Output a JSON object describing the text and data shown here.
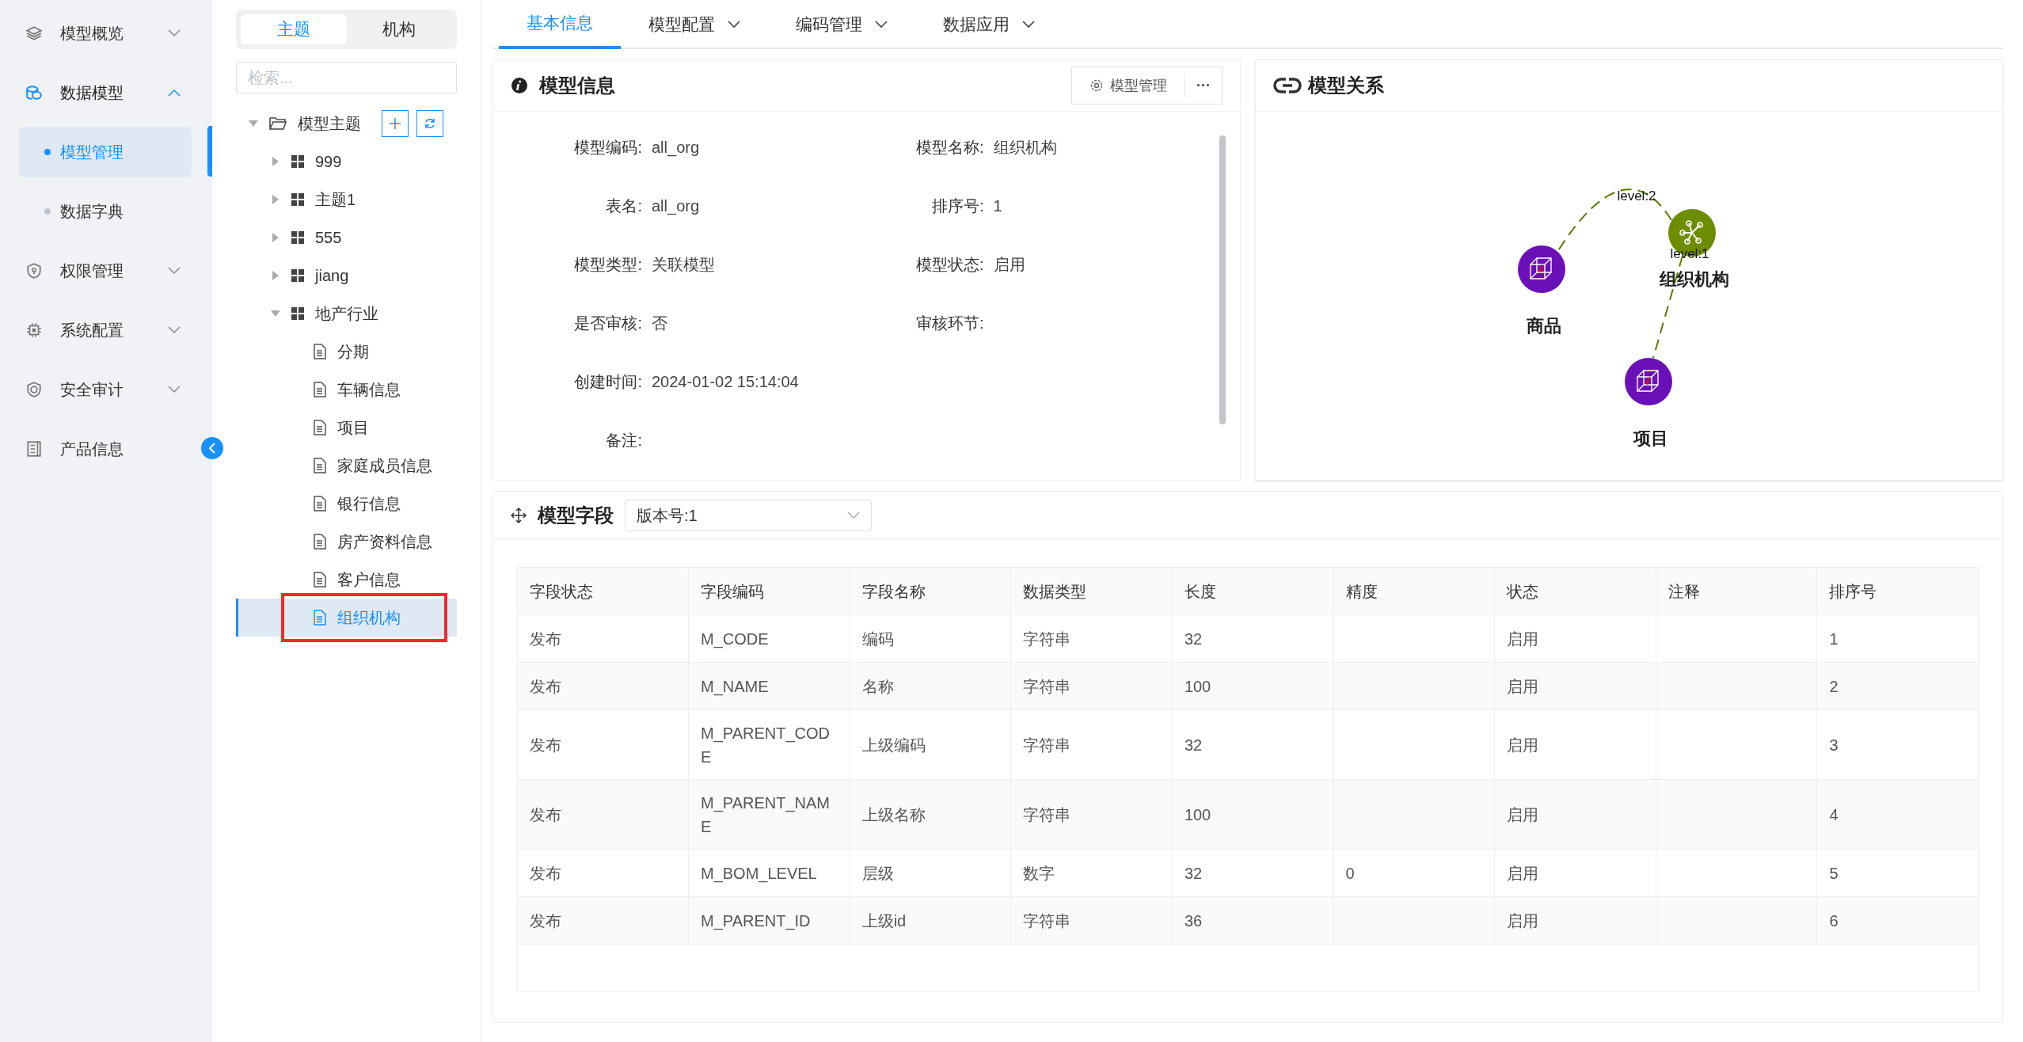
{
  "sidebar": {
    "items": [
      {
        "label": "模型概览",
        "expanded": false
      },
      {
        "label": "数据模型",
        "expanded": true,
        "children": [
          {
            "label": "模型管理",
            "selected": true
          },
          {
            "label": "数据字典",
            "selected": false
          }
        ]
      },
      {
        "label": "权限管理",
        "expanded": false
      },
      {
        "label": "系统配置",
        "expanded": false
      },
      {
        "label": "安全审计",
        "expanded": false
      },
      {
        "label": "产品信息"
      }
    ]
  },
  "tree_panel": {
    "tabs": [
      {
        "label": "主题",
        "selected": true
      },
      {
        "label": "机构",
        "selected": false
      }
    ],
    "search": {
      "placeholder": "检索..."
    },
    "tree": [
      {
        "label": "模型主题",
        "kind": "folder",
        "expanded": true,
        "children": [
          {
            "label": "999",
            "kind": "group",
            "expanded": false
          },
          {
            "label": "主题1",
            "kind": "group",
            "expanded": false
          },
          {
            "label": "555",
            "kind": "group",
            "expanded": false
          },
          {
            "label": "jiang",
            "kind": "group",
            "expanded": false
          },
          {
            "label": "地产行业",
            "kind": "group",
            "expanded": true,
            "children": [
              {
                "label": "分期",
                "kind": "model",
                "selected": false,
                "marked": false
              },
              {
                "label": "车辆信息",
                "kind": "model",
                "selected": false,
                "marked": false
              },
              {
                "label": "项目",
                "kind": "model",
                "selected": false,
                "marked": false
              },
              {
                "label": "家庭成员信息",
                "kind": "model",
                "selected": false,
                "marked": false
              },
              {
                "label": "银行信息",
                "kind": "model",
                "selected": false,
                "marked": false
              },
              {
                "label": "房产资料信息",
                "kind": "model",
                "selected": false,
                "marked": false
              },
              {
                "label": "客户信息",
                "kind": "model",
                "selected": false,
                "marked": false
              },
              {
                "label": "组织机构",
                "kind": "model",
                "selected": true,
                "marked": true
              }
            ]
          }
        ]
      }
    ]
  },
  "tabs": [
    {
      "label": "基本信息",
      "selected": true,
      "dropdown": false
    },
    {
      "label": "模型配置",
      "selected": false,
      "dropdown": true
    },
    {
      "label": "编码管理",
      "selected": false,
      "dropdown": true
    },
    {
      "label": "数据应用",
      "selected": false,
      "dropdown": true
    }
  ],
  "model_info": {
    "title": "模型信息",
    "manage_button": "模型管理",
    "more_button": "···",
    "fields": [
      {
        "label": "模型编码:",
        "value": "all_org"
      },
      {
        "label": "模型名称:",
        "value": "组织机构"
      },
      {
        "label": "表名:",
        "value": "all_org"
      },
      {
        "label": "排序号:",
        "value": "1"
      },
      {
        "label": "模型类型:",
        "value": "关联模型"
      },
      {
        "label": "模型状态:",
        "value": "启用"
      },
      {
        "label": "是否审核:",
        "value": "否"
      },
      {
        "label": "审核环节:"
      },
      {
        "label": "创建时间:",
        "value": "2024-01-02 15:14:04"
      },
      {
        "label": "备注:"
      }
    ]
  },
  "relations": {
    "title": "模型关系",
    "nodes": [
      {
        "label": "商品",
        "kind": "model"
      },
      {
        "label": "组织机构",
        "kind": "center"
      },
      {
        "label": "项目",
        "kind": "model"
      }
    ],
    "edges": [
      {
        "label": "level:2"
      },
      {
        "label": "level:1"
      }
    ]
  },
  "fields_table": {
    "title": "模型字段",
    "version": "版本号:1",
    "columns": [
      "字段状态",
      "字段编码",
      "字段名称",
      "数据类型",
      "长度",
      "精度",
      "状态",
      "注释",
      "排序号"
    ],
    "rows": [
      {
        "field_status": "发布",
        "field_code": "M_CODE",
        "field_name": "编码",
        "data_type": "字符串",
        "length": "32",
        "status": "启用",
        "order": "1"
      },
      {
        "field_status": "发布",
        "field_code": "M_NAME",
        "field_name": "名称",
        "data_type": "字符串",
        "length": "100",
        "status": "启用",
        "order": "2"
      },
      {
        "field_status": "发布",
        "field_code": "M_PARENT_CODE",
        "field_name": "上级编码",
        "data_type": "字符串",
        "length": "32",
        "status": "启用",
        "order": "3"
      },
      {
        "field_status": "发布",
        "field_code": "M_PARENT_NAME",
        "field_name": "上级名称",
        "data_type": "字符串",
        "length": "100",
        "status": "启用",
        "order": "4"
      },
      {
        "field_status": "发布",
        "field_code": "M_BOM_LEVEL",
        "field_name": "层级",
        "data_type": "数字",
        "length": "32",
        "precision": "0",
        "status": "启用",
        "order": "5"
      },
      {
        "field_status": "发布",
        "field_code": "M_PARENT_ID",
        "field_name": "上级id",
        "data_type": "字符串",
        "length": "36",
        "status": "启用",
        "order": "6"
      }
    ]
  }
}
